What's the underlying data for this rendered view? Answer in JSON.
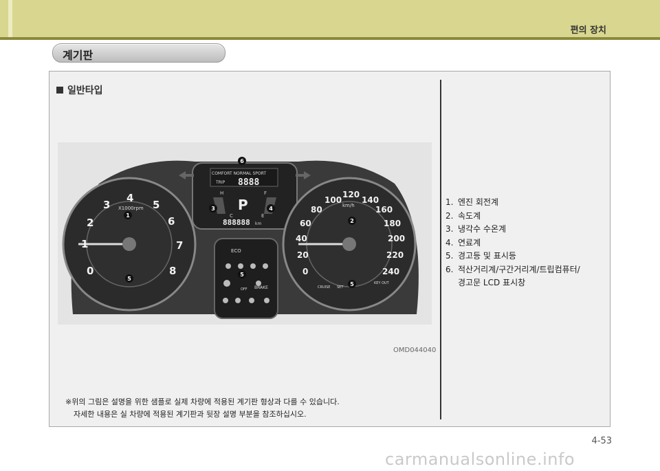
{
  "header": {
    "title": "편의 장치"
  },
  "section": {
    "title": "계기판"
  },
  "panel": {
    "subheading": "일반타입",
    "photo_code": "OMD044040",
    "note": [
      "※위의 그림은 설명을 위한 샘플로 실제 차량에 적용된 계기판 형상과 다를 수 있습니다.",
      "자세한 내용은 실 차량에 적용된 계기판과 뒷장 설명 부분을 참조하십시오."
    ],
    "legend": [
      {
        "num": "1.",
        "label": "엔진 회전계"
      },
      {
        "num": "2.",
        "label": "속도계"
      },
      {
        "num": "3.",
        "label": "냉각수 수온계"
      },
      {
        "num": "4.",
        "label": "연료계"
      },
      {
        "num": "5.",
        "label": "경고등 및 표시등"
      },
      {
        "num": "6.",
        "label": "적산거리계/구간거리계/트립컴퓨터/"
      }
    ],
    "legend_cont": "경고문 LCD 표시창"
  },
  "cluster": {
    "tach_numbers": [
      "0",
      "1",
      "2",
      "3",
      "4",
      "5",
      "6",
      "7",
      "8"
    ],
    "tach_unit": "X1000rpm",
    "speed_numbers": [
      "0",
      "20",
      "40",
      "60",
      "80",
      "100",
      "120",
      "140",
      "160",
      "180",
      "200",
      "220",
      "240"
    ],
    "speed_unit": "km/h",
    "lcd_modes": "COMFORT NORMAL SPORT",
    "lcd_trip": "TRIP",
    "lcd_digits": "8888",
    "lcd_odo": "888888",
    "lcd_odo_unit": "km",
    "lcd_h": "H",
    "lcd_c": "C",
    "lcd_f": "F",
    "lcd_e": "E",
    "lcd_gear": "P",
    "eco": "ECO",
    "brake": "BRAKE",
    "off": "OFF",
    "cruise": "CRUISE",
    "set": "SET",
    "key_out": "KEY OUT",
    "callouts": [
      "1",
      "2",
      "3",
      "4",
      "5",
      "5",
      "5",
      "6"
    ]
  },
  "footer": {
    "page": "4-53",
    "watermark": "carmanualsonline.info"
  }
}
